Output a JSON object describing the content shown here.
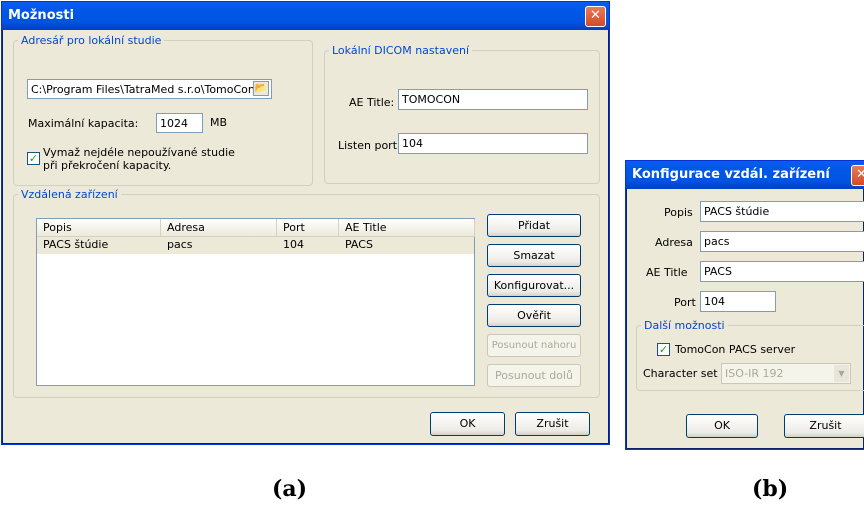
{
  "dialog_a": {
    "title": "Možnosti",
    "local_group": {
      "legend": "Adresář pro lokální studie",
      "path_value": "C:\\Program Files\\TatraMed s.r.o\\TomoCon",
      "capacity_label": "Maximální kapacita:",
      "capacity_value": "1024",
      "capacity_unit": "MB",
      "delete_checkbox_label_1": "Vymaž nejdéle nepoužívané studie",
      "delete_checkbox_label_2": "při překročení kapacity.",
      "delete_checked": true
    },
    "dicom_group": {
      "legend": "Lokální DICOM nastavení",
      "ae_title_label": "AE Title:",
      "ae_title_value": "TOMOCON",
      "port_label": "Listen port:",
      "port_value": "104"
    },
    "remote_group": {
      "legend": "Vzdálená zařízení",
      "columns": [
        "Popis",
        "Adresa",
        "Port",
        "AE Title"
      ],
      "rows": [
        [
          "PACS štúdie",
          "pacs",
          "104",
          "PACS"
        ]
      ]
    },
    "buttons": {
      "add": "Přidat",
      "delete": "Smazat",
      "configure": "Konfigurovat...",
      "verify": "Ověřit",
      "move_up": "Posunout nahoru",
      "move_down": "Posunout dolů",
      "ok": "OK",
      "cancel": "Zrušit"
    }
  },
  "dialog_b": {
    "title": "Konfigurace vzdál. zařízení",
    "popis_label": "Popis",
    "popis_value": "PACS štúdie",
    "adresa_label": "Adresa",
    "adresa_value": "pacs",
    "ae_title_label": "AE Title",
    "ae_title_value": "PACS",
    "port_label": "Port",
    "port_value": "104",
    "more_legend": "Další možnosti",
    "pacs_server_label": "TomoCon PACS server",
    "pacs_server_checked": true,
    "charset_label": "Character set",
    "charset_value": "ISO-IR 192",
    "ok": "OK",
    "cancel": "Zrušit"
  },
  "captions": {
    "a": "(a)",
    "b": "(b)"
  },
  "colors": {
    "title_bar": "#0054e3",
    "legend_text": "#0046d5",
    "close_button": "#d34a26",
    "selected_row": "#ece9d8"
  }
}
